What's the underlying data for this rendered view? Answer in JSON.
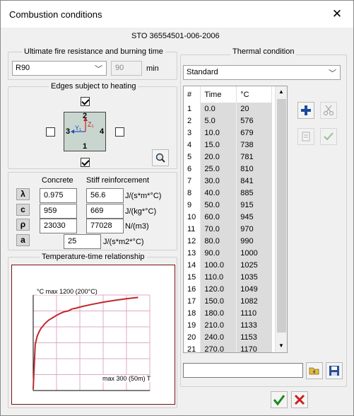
{
  "window": {
    "title": "Combustion conditions",
    "close_glyph": "✕"
  },
  "standard": "STO 36554501-006-2006",
  "fire_resistance": {
    "legend": "Ultimate fire resistance and burning time",
    "selected": "R90",
    "minutes": "90",
    "unit": "min"
  },
  "edges": {
    "legend": "Edges subject to heating",
    "top_checked": true,
    "left_checked": false,
    "right_checked": false,
    "bottom_checked": true,
    "labels": {
      "top": "2",
      "left": "3",
      "right": "4",
      "bottom": "1",
      "y_axis": "Y₁",
      "z_axis": "Z₁"
    }
  },
  "materials": {
    "concrete_header": "Concrete",
    "reinforcement_header": "Stiff reinforcement",
    "rows": [
      {
        "symbol": "λ",
        "concrete": "0.975",
        "reinforcement": "56.6",
        "unit": "J/(s*m*°C)"
      },
      {
        "symbol": "c",
        "concrete": "959",
        "reinforcement": "669",
        "unit": "J/(kg*°C)"
      },
      {
        "symbol": "ρ",
        "concrete": "23030",
        "reinforcement": "77028",
        "unit": "N/(m3)"
      }
    ],
    "alpha": {
      "symbol": "a",
      "value": "25",
      "unit": "J/(s*m2*°C)"
    }
  },
  "chart": {
    "legend": "Temperature-time relationship",
    "ylabel": "°C max 1200 (200°C)",
    "xlabel": "max 300 (50m) T",
    "line_color": "#c0282d"
  },
  "chart_data": {
    "type": "line",
    "x": [
      0,
      5,
      10,
      15,
      20,
      25,
      30,
      40,
      50,
      60,
      70,
      80,
      90,
      100,
      110,
      120,
      150,
      180,
      210,
      240,
      270
    ],
    "values": [
      20,
      576,
      679,
      738,
      781,
      810,
      841,
      885,
      915,
      945,
      970,
      990,
      1000,
      1025,
      1035,
      1049,
      1082,
      1110,
      1133,
      1153,
      1170
    ],
    "xlim": [
      0,
      300
    ],
    "ylim": [
      0,
      1200
    ]
  },
  "thermal": {
    "legend": "Thermal condition",
    "selected": "Standard",
    "headers": [
      "#",
      "Time",
      "°C"
    ],
    "rows": [
      [
        "1",
        "0.0",
        "20"
      ],
      [
        "2",
        "5.0",
        "576"
      ],
      [
        "3",
        "10.0",
        "679"
      ],
      [
        "4",
        "15.0",
        "738"
      ],
      [
        "5",
        "20.0",
        "781"
      ],
      [
        "6",
        "25.0",
        "810"
      ],
      [
        "7",
        "30.0",
        "841"
      ],
      [
        "8",
        "40.0",
        "885"
      ],
      [
        "9",
        "50.0",
        "915"
      ],
      [
        "10",
        "60.0",
        "945"
      ],
      [
        "11",
        "70.0",
        "970"
      ],
      [
        "12",
        "80.0",
        "990"
      ],
      [
        "13",
        "90.0",
        "1000"
      ],
      [
        "14",
        "100.0",
        "1025"
      ],
      [
        "15",
        "110.0",
        "1035"
      ],
      [
        "16",
        "120.0",
        "1049"
      ],
      [
        "17",
        "150.0",
        "1082"
      ],
      [
        "18",
        "180.0",
        "1110"
      ],
      [
        "19",
        "210.0",
        "1133"
      ],
      [
        "20",
        "240.0",
        "1153"
      ],
      [
        "21",
        "270.0",
        "1170"
      ]
    ]
  },
  "file_path": "",
  "colors": {
    "plus": "#1c4a9c",
    "ok": "#1a8a1a",
    "cancel": "#cc1f1f"
  }
}
